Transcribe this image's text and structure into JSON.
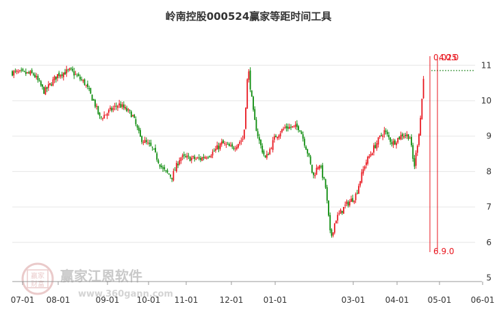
{
  "chart_data": {
    "type": "candlestick",
    "title": "岭南控股000524赢家等距时间工具",
    "y_ticks": [
      "11",
      "10",
      "9",
      "8",
      "7",
      "6",
      "5"
    ],
    "ylim": [
      5,
      11.3
    ],
    "x_ticks": [
      "07-01",
      "08-01",
      "09-01",
      "10-01",
      "11-01",
      "12-01",
      "01-01",
      "03-01",
      "04-01",
      "05-01",
      "06-01"
    ],
    "grid": "horizontal",
    "up_color": "#e8141c",
    "down_color": "#0a8a0a",
    "annotations": {
      "top_left": "0.0",
      "top_mid": "4.25",
      "top_right": "0.0",
      "bottom_label": "6.9.0",
      "reference_price": 10.85
    },
    "price_path": [
      {
        "d": "07-01",
        "v": 10.8
      },
      {
        "d": "07-15",
        "v": 10.75
      },
      {
        "d": "07-22",
        "v": 10.25
      },
      {
        "d": "08-01",
        "v": 10.75
      },
      {
        "d": "08-10",
        "v": 10.85
      },
      {
        "d": "08-20",
        "v": 10.5
      },
      {
        "d": "08-27",
        "v": 9.95
      },
      {
        "d": "09-01",
        "v": 9.5
      },
      {
        "d": "09-15",
        "v": 9.9
      },
      {
        "d": "09-25",
        "v": 9.6
      },
      {
        "d": "10-01",
        "v": 8.95
      },
      {
        "d": "10-10",
        "v": 8.65
      },
      {
        "d": "10-18",
        "v": 8.05
      },
      {
        "d": "10-25",
        "v": 7.85
      },
      {
        "d": "11-01",
        "v": 8.4
      },
      {
        "d": "11-15",
        "v": 8.35
      },
      {
        "d": "11-25",
        "v": 8.55
      },
      {
        "d": "12-01",
        "v": 8.8
      },
      {
        "d": "12-08",
        "v": 8.65
      },
      {
        "d": "12-16",
        "v": 8.95
      },
      {
        "d": "12-19",
        "v": 10.95
      },
      {
        "d": "12-23",
        "v": 9.5
      },
      {
        "d": "12-27",
        "v": 8.8
      },
      {
        "d": "01-01",
        "v": 8.35
      },
      {
        "d": "01-08",
        "v": 9.0
      },
      {
        "d": "01-15",
        "v": 9.25
      },
      {
        "d": "01-25",
        "v": 9.25
      },
      {
        "d": "01-31",
        "v": 8.5
      },
      {
        "d": "02-05",
        "v": 7.85
      },
      {
        "d": "02-10",
        "v": 8.25
      },
      {
        "d": "02-15",
        "v": 7.55
      },
      {
        "d": "02-19",
        "v": 6.1
      },
      {
        "d": "02-23",
        "v": 6.65
      },
      {
        "d": "03-01",
        "v": 7.05
      },
      {
        "d": "03-08",
        "v": 7.3
      },
      {
        "d": "03-15",
        "v": 8.2
      },
      {
        "d": "03-22",
        "v": 8.7
      },
      {
        "d": "03-29",
        "v": 9.15
      },
      {
        "d": "04-05",
        "v": 8.8
      },
      {
        "d": "04-12",
        "v": 9.05
      },
      {
        "d": "04-17",
        "v": 9.0
      },
      {
        "d": "04-20",
        "v": 8.1
      },
      {
        "d": "04-24",
        "v": 9.3
      },
      {
        "d": "04-27",
        "v": 10.85
      }
    ]
  },
  "watermark": {
    "brand": "赢家江恩软件",
    "url": "www.360gann.com",
    "seal_top": "赢家",
    "seal_bottom": "财富"
  }
}
